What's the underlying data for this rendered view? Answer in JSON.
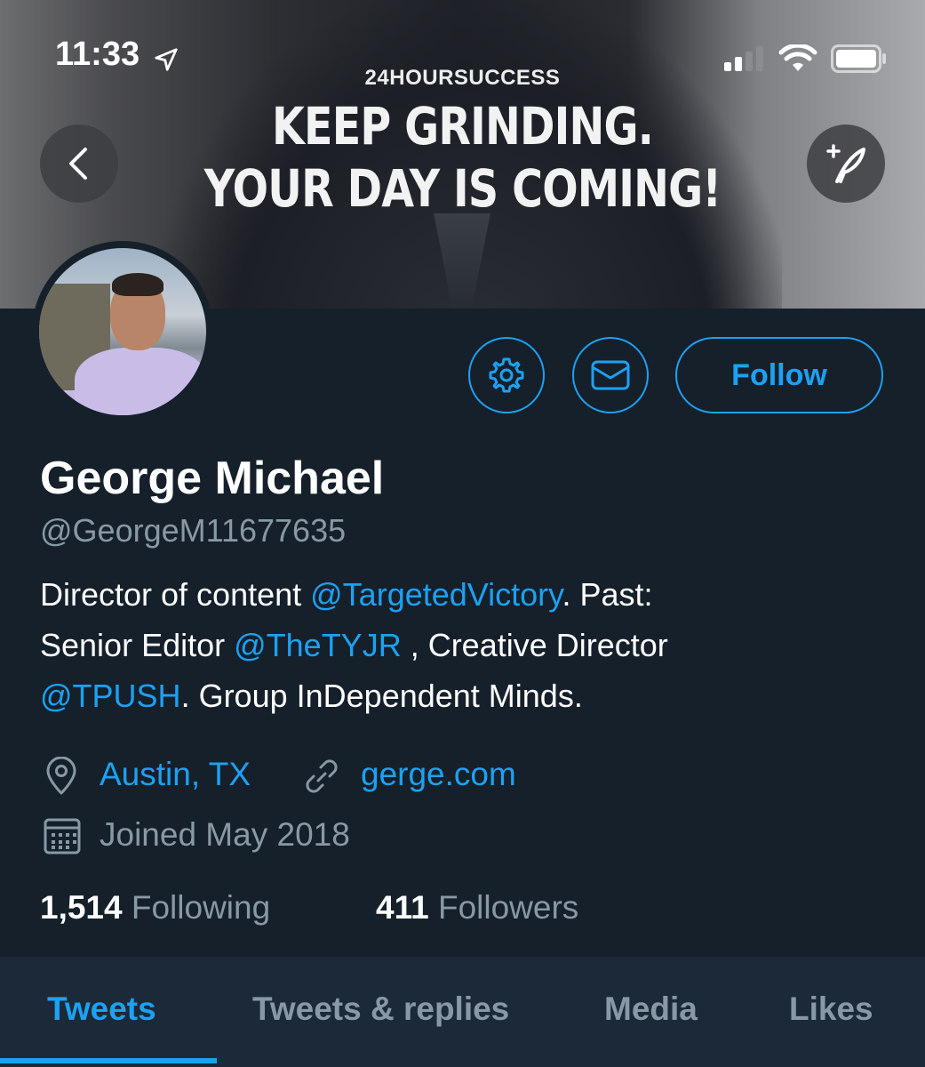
{
  "status_bar": {
    "time": "11:33"
  },
  "banner": {
    "brand": "24HOURSUCCESS",
    "line1": "KEEP GRINDING.",
    "line2": "YOUR DAY IS COMING!"
  },
  "actions": {
    "follow_label": "Follow"
  },
  "profile": {
    "name": "George Michael",
    "handle": "@GeorgeM11677635",
    "bio": {
      "part1": "Director of content ",
      "mention1": "@TargetedVictory",
      "part2": ". Past:",
      "part3": "Senior Editor ",
      "mention2": "@TheTYJR",
      "part4": " , Creative Director",
      "mention3": "@TPUSH",
      "part5": ". Group InDependent Minds."
    },
    "location": "Austin, TX",
    "website": "gerge.com",
    "joined": "Joined May 2018"
  },
  "stats": {
    "following_count": "1,514",
    "following_label": "Following",
    "followers_count": "411",
    "followers_label": "Followers"
  },
  "tabs": [
    {
      "label": "Tweets",
      "active": true
    },
    {
      "label": "Tweets & replies",
      "active": false
    },
    {
      "label": "Media",
      "active": false
    },
    {
      "label": "Likes",
      "active": false
    }
  ],
  "colors": {
    "accent": "#1da1f2",
    "background": "#15202b",
    "secondary_text": "#8899a6"
  },
  "icons": [
    "location-arrow-icon",
    "signal-icon",
    "wifi-icon",
    "battery-icon",
    "back-arrow-icon",
    "compose-tweet-icon",
    "gear-icon",
    "envelope-icon",
    "location-pin-icon",
    "link-icon",
    "calendar-icon"
  ]
}
